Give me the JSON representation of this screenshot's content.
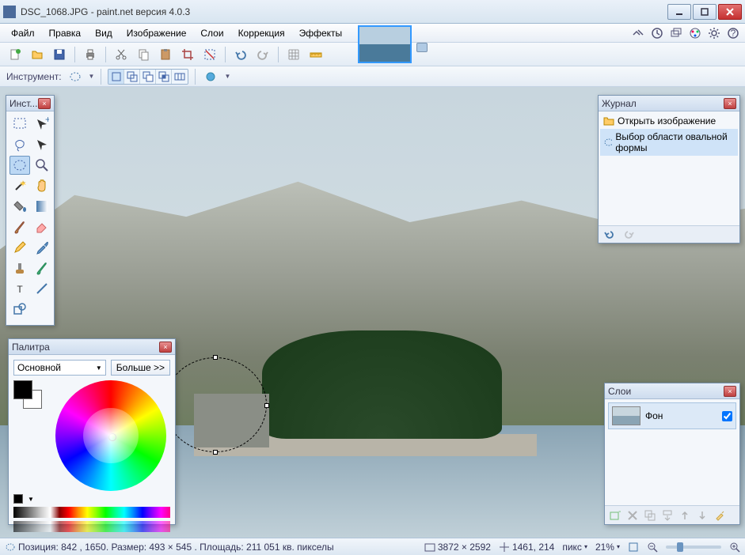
{
  "title": "DSC_1068.JPG - paint.net версия 4.0.3",
  "menu": {
    "file": "Файл",
    "edit": "Правка",
    "view": "Вид",
    "image": "Изображение",
    "layers": "Слои",
    "adjustments": "Коррекция",
    "effects": "Эффекты"
  },
  "toolbar2": {
    "label": "Инструмент:"
  },
  "panels": {
    "tools": {
      "title": "Инст..."
    },
    "colors": {
      "title": "Палитра",
      "primary_label": "Основной",
      "more": "Больше >>",
      "fg": "#000000",
      "bg": "#ffffff"
    },
    "history": {
      "title": "Журнал",
      "items": [
        {
          "label": "Открыть изображение",
          "icon": "open"
        },
        {
          "label": "Выбор области овальной формы",
          "icon": "ellipse",
          "selected": true
        }
      ]
    },
    "layers": {
      "title": "Слои",
      "items": [
        {
          "name": "Фон",
          "visible": true
        }
      ]
    }
  },
  "status": {
    "selection": "Позиция: 842 , 1650. Размер: 493  × 545 . Площадь: 211 051 кв. пикселы",
    "image_size": "3872 × 2592",
    "cursor": "1461, 214",
    "units": "пикс",
    "zoom": "21%"
  }
}
